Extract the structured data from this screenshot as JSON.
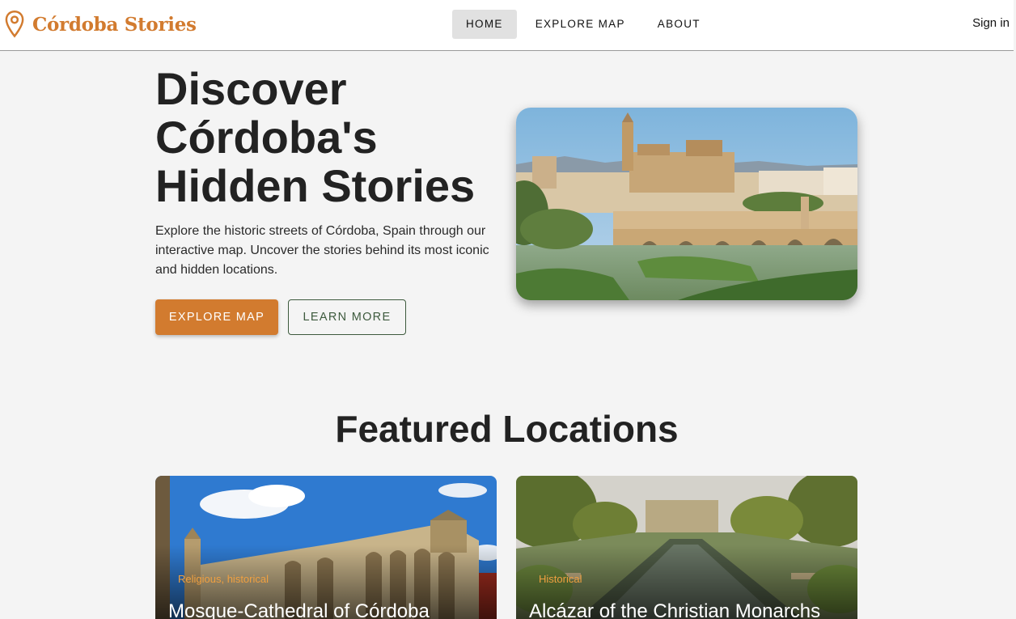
{
  "header": {
    "brand": "Córdoba Stories",
    "nav": [
      "HOME",
      "EXPLORE MAP",
      "ABOUT"
    ],
    "active_nav": "HOME",
    "signin": "Sign in"
  },
  "hero": {
    "title": "Discover Córdoba's Hidden Stories",
    "description": "Explore the historic streets of Córdoba, Spain through our interactive map. Uncover the stories behind its most iconic and hidden locations.",
    "primary_button": "EXPLORE MAP",
    "secondary_button": "LEARN MORE"
  },
  "featured": {
    "title": "Featured Locations",
    "cards": [
      {
        "tags": "Religious, historical",
        "name": "Mosque-Cathedral of Córdoba"
      },
      {
        "tags": "Historical",
        "name": "Alcázar of the Christian Monarchs"
      }
    ]
  },
  "colors": {
    "accent": "#d27b2f",
    "secondary": "#3d5a3d",
    "background": "#f4f4f4"
  },
  "icons": {
    "brand": "map-pin-icon"
  }
}
